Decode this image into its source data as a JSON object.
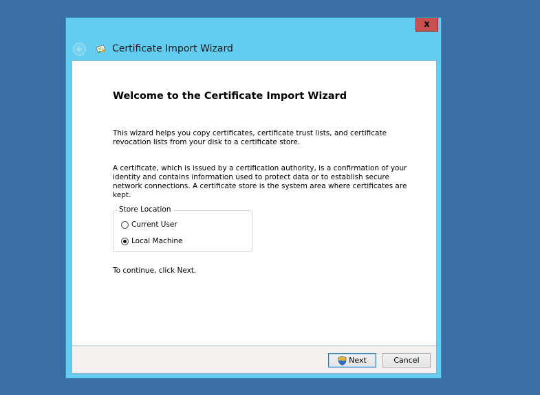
{
  "window": {
    "title": "Certificate Import Wizard",
    "close_label": "x",
    "title_color": "#63cdf1",
    "close_color": "#c75050"
  },
  "icons": {
    "back": "back-arrow-icon",
    "cert": "certificate-icon",
    "shield": "uac-shield-icon"
  },
  "main": {
    "heading": "Welcome to the Certificate Import Wizard",
    "para1": "This wizard helps you copy certificates, certificate trust lists, and certificate revocation lists from your disk to a certificate store.",
    "para2": "A certificate, which is issued by a certification authority, is a confirmation of your identity and contains information used to protect data or to establish secure network connections. A certificate store is the system area where certificates are kept.",
    "store_location": {
      "label": "Store Location",
      "options": [
        {
          "label": "Current User",
          "selected": false
        },
        {
          "label": "Local Machine",
          "selected": true
        }
      ]
    },
    "continue_text": "To continue, click Next."
  },
  "footer": {
    "next_label": "Next",
    "cancel_label": "Cancel"
  }
}
